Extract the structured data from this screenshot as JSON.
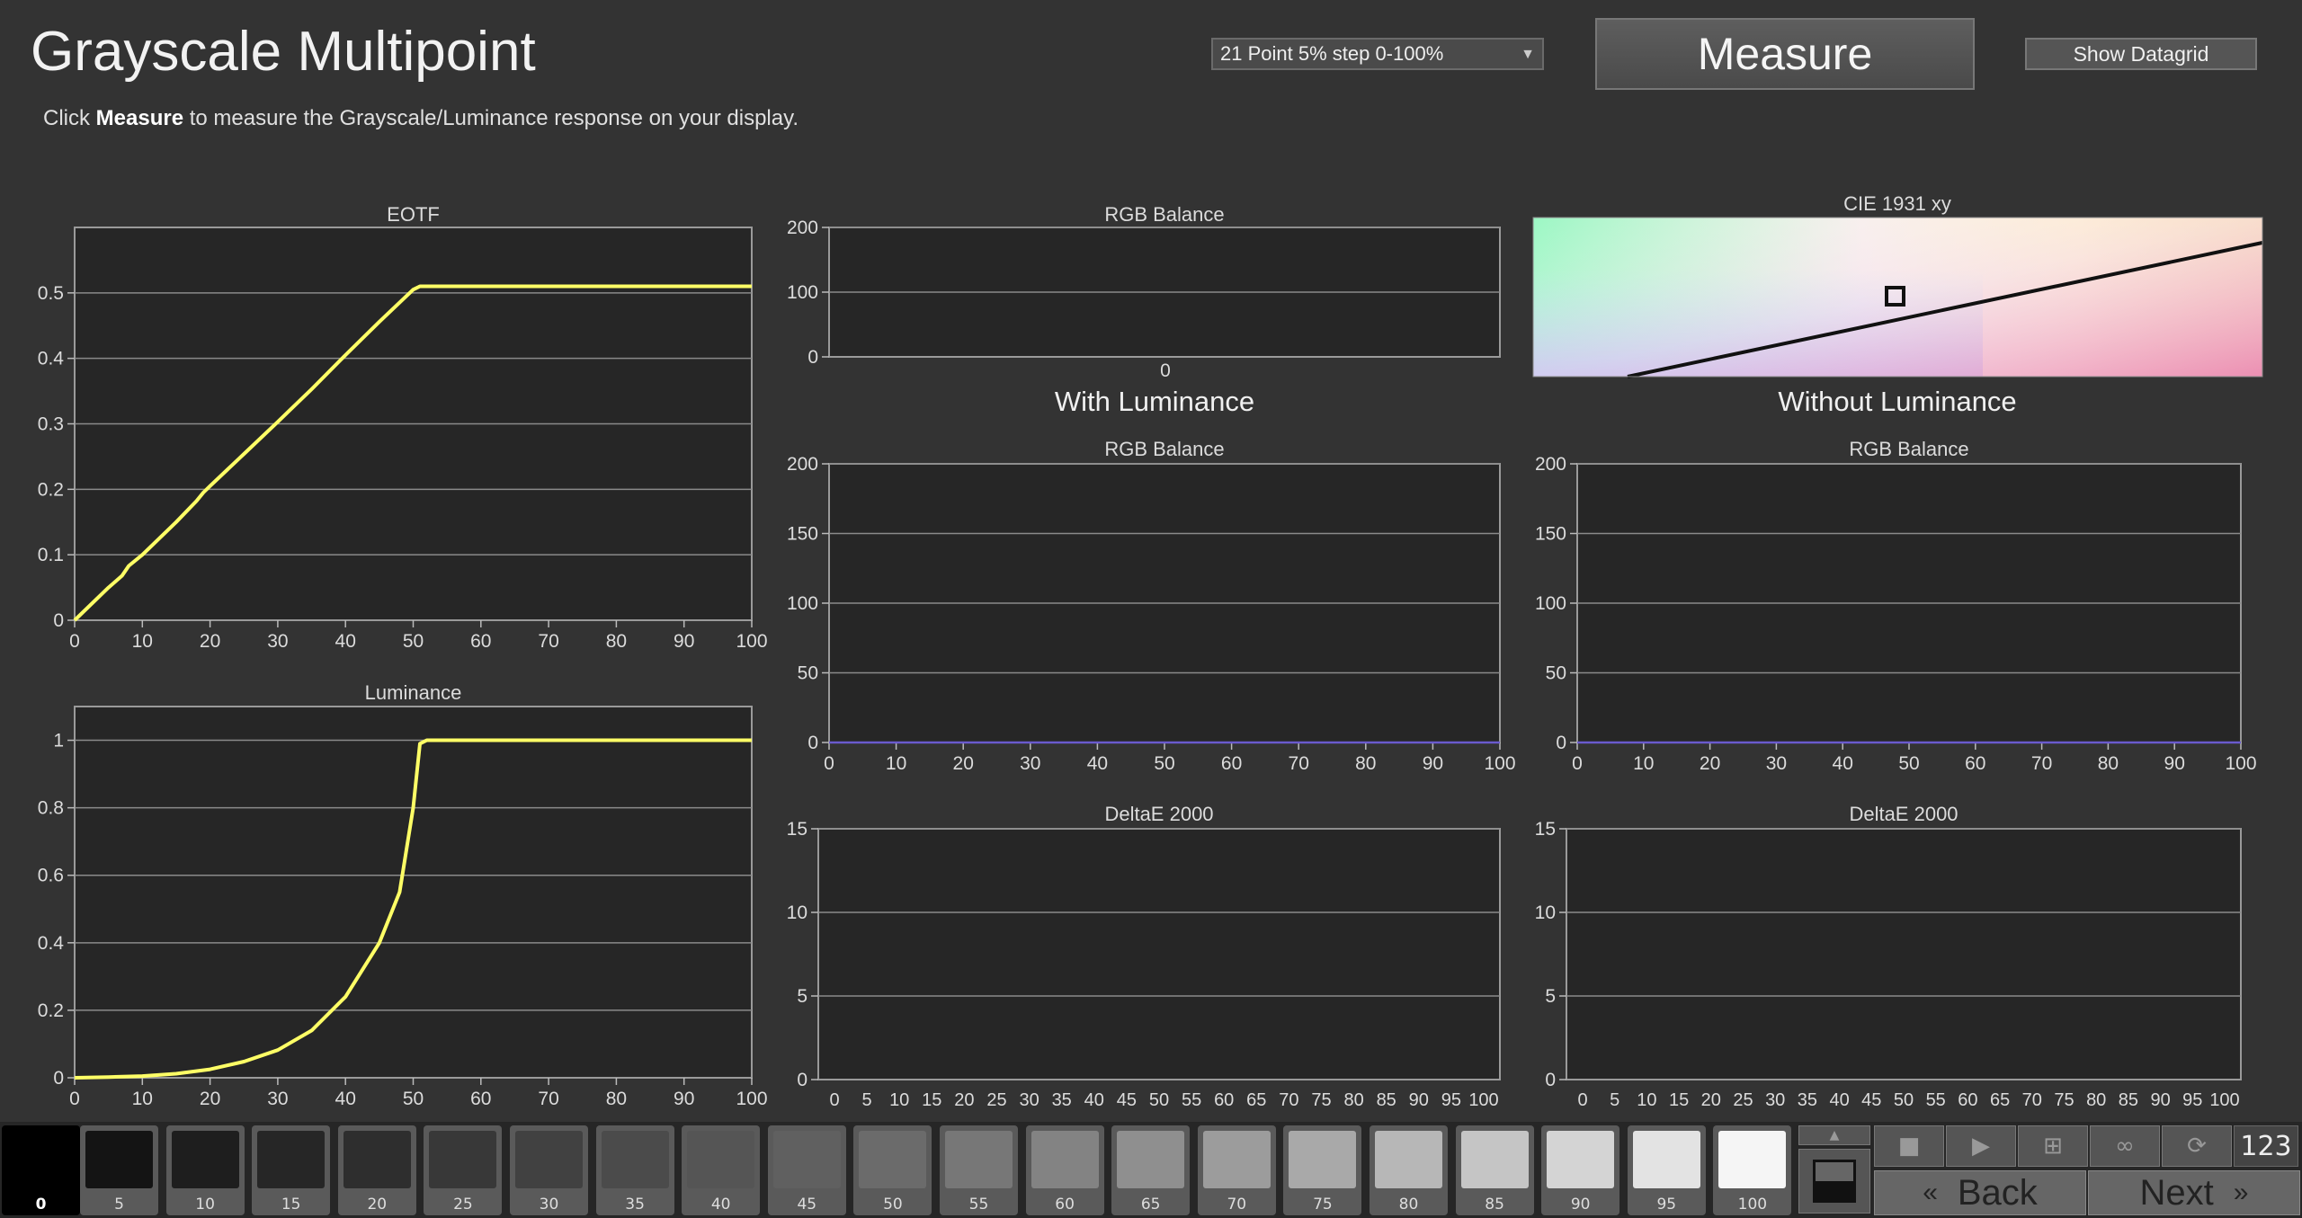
{
  "header": {
    "title": "Grayscale Multipoint",
    "subtitle_prefix": "Click ",
    "subtitle_bold": "Measure",
    "subtitle_suffix": " to measure the Grayscale/Luminance response on your display."
  },
  "toolbar": {
    "preset_value": "21 Point 5% step 0-100%",
    "measure_label": "Measure",
    "datagrid_label": "Show Datagrid"
  },
  "sections": {
    "with_luminance": "With Luminance",
    "without_luminance": "Without Luminance"
  },
  "colors": {
    "curve": "#ffff66",
    "baseline": "#6a5acd",
    "plot_bg": "#262626",
    "grid": "#8a8a8a"
  },
  "chart_data": [
    {
      "id": "eotf",
      "type": "line",
      "title": "EOTF",
      "xlim": [
        0,
        100
      ],
      "ylim": [
        0,
        0.6
      ],
      "xticks": [
        0,
        10,
        20,
        30,
        40,
        50,
        60,
        70,
        80,
        90,
        100
      ],
      "yticks": [
        0,
        0.1,
        0.2,
        0.3,
        0.4,
        0.5
      ],
      "ytick_labels": [
        "0",
        "0.1",
        "0.2",
        "0.3",
        "0.4",
        "0.5"
      ],
      "series": [
        {
          "x": [
            0,
            5,
            7,
            8,
            10,
            15,
            18,
            19,
            20,
            25,
            30,
            32,
            35,
            40,
            45,
            50,
            51,
            60,
            70,
            80,
            90,
            100
          ],
          "values": [
            0,
            0.05,
            0.068,
            0.083,
            0.1,
            0.15,
            0.182,
            0.195,
            0.205,
            0.254,
            0.303,
            0.323,
            0.353,
            0.405,
            0.456,
            0.505,
            0.51,
            0.51,
            0.51,
            0.51,
            0.51,
            0.51
          ]
        }
      ]
    },
    {
      "id": "luminance",
      "type": "line",
      "title": "Luminance",
      "xlim": [
        0,
        100
      ],
      "ylim": [
        0,
        1.1
      ],
      "xticks": [
        0,
        10,
        20,
        30,
        40,
        50,
        60,
        70,
        80,
        90,
        100
      ],
      "yticks": [
        0,
        0.2,
        0.4,
        0.6,
        0.8,
        1
      ],
      "ytick_labels": [
        "0",
        "0.2",
        "0.4",
        "0.6",
        "0.8",
        "1"
      ],
      "series": [
        {
          "x": [
            0,
            5,
            10,
            15,
            20,
            25,
            30,
            35,
            40,
            45,
            48,
            50,
            51,
            52,
            60,
            70,
            80,
            90,
            100
          ],
          "values": [
            0,
            0.002,
            0.005,
            0.012,
            0.025,
            0.048,
            0.082,
            0.14,
            0.24,
            0.4,
            0.55,
            0.8,
            0.99,
            1.0,
            1.0,
            1.0,
            1.0,
            1.0,
            1.0
          ]
        }
      ]
    },
    {
      "id": "rgb-top",
      "type": "bar",
      "title": "RGB Balance",
      "ylim": [
        0,
        200
      ],
      "yticks": [
        0,
        100,
        200
      ],
      "ytick_labels": [
        "0",
        "100",
        "200"
      ],
      "categories": [
        "0"
      ],
      "series": []
    },
    {
      "id": "cie",
      "type": "scatter",
      "title": "CIE 1931 xy",
      "series": []
    },
    {
      "id": "rgb-with",
      "type": "line",
      "title": "RGB Balance",
      "xlim": [
        0,
        100
      ],
      "ylim": [
        0,
        200
      ],
      "xticks": [
        0,
        10,
        20,
        30,
        40,
        50,
        60,
        70,
        80,
        90,
        100
      ],
      "yticks": [
        0,
        50,
        100,
        150,
        200
      ],
      "ytick_labels": [
        "0",
        "50",
        "100",
        "150",
        "200"
      ],
      "series": [
        {
          "x": [
            0,
            100
          ],
          "values": [
            0,
            0
          ]
        }
      ]
    },
    {
      "id": "rgb-without",
      "type": "line",
      "title": "RGB Balance",
      "xlim": [
        0,
        100
      ],
      "ylim": [
        0,
        200
      ],
      "xticks": [
        0,
        10,
        20,
        30,
        40,
        50,
        60,
        70,
        80,
        90,
        100
      ],
      "yticks": [
        0,
        50,
        100,
        150,
        200
      ],
      "ytick_labels": [
        "0",
        "50",
        "100",
        "150",
        "200"
      ],
      "series": [
        {
          "x": [
            0,
            100
          ],
          "values": [
            0,
            0
          ]
        }
      ]
    },
    {
      "id": "de-with",
      "type": "bar",
      "title": "DeltaE 2000",
      "ylim": [
        0,
        15
      ],
      "yticks": [
        0,
        5,
        10,
        15
      ],
      "ytick_labels": [
        "0",
        "5",
        "10",
        "15"
      ],
      "categories": [
        "0",
        "5",
        "10",
        "15",
        "20",
        "25",
        "30",
        "35",
        "40",
        "45",
        "50",
        "55",
        "60",
        "65",
        "70",
        "75",
        "80",
        "85",
        "90",
        "95",
        "100"
      ],
      "series": []
    },
    {
      "id": "de-without",
      "type": "bar",
      "title": "DeltaE 2000",
      "ylim": [
        0,
        15
      ],
      "yticks": [
        0,
        5,
        10,
        15
      ],
      "ytick_labels": [
        "0",
        "5",
        "10",
        "15"
      ],
      "categories": [
        "0",
        "5",
        "10",
        "15",
        "20",
        "25",
        "30",
        "35",
        "40",
        "45",
        "50",
        "55",
        "60",
        "65",
        "70",
        "75",
        "80",
        "85",
        "90",
        "95",
        "100"
      ],
      "series": []
    }
  ],
  "patches": [
    {
      "label": "0",
      "gray": "#000000"
    },
    {
      "label": "5",
      "gray": "#141414"
    },
    {
      "label": "10",
      "gray": "#1e1e1e"
    },
    {
      "label": "15",
      "gray": "#262626"
    },
    {
      "label": "20",
      "gray": "#2e2e2e"
    },
    {
      "label": "25",
      "gray": "#383838"
    },
    {
      "label": "30",
      "gray": "#414141"
    },
    {
      "label": "35",
      "gray": "#4b4b4b"
    },
    {
      "label": "40",
      "gray": "#555555"
    },
    {
      "label": "45",
      "gray": "#606060"
    },
    {
      "label": "50",
      "gray": "#6b6b6b"
    },
    {
      "label": "55",
      "gray": "#777777"
    },
    {
      "label": "60",
      "gray": "#838383"
    },
    {
      "label": "65",
      "gray": "#8f8f8f"
    },
    {
      "label": "70",
      "gray": "#9c9c9c"
    },
    {
      "label": "75",
      "gray": "#a9a9a9"
    },
    {
      "label": "80",
      "gray": "#b7b7b7"
    },
    {
      "label": "85",
      "gray": "#c5c5c5"
    },
    {
      "label": "90",
      "gray": "#d4d4d4"
    },
    {
      "label": "95",
      "gray": "#e3e3e3"
    },
    {
      "label": "100",
      "gray": "#f5f5f5"
    }
  ],
  "nav": {
    "back_label": "Back",
    "next_label": "Next",
    "counter": "123"
  }
}
